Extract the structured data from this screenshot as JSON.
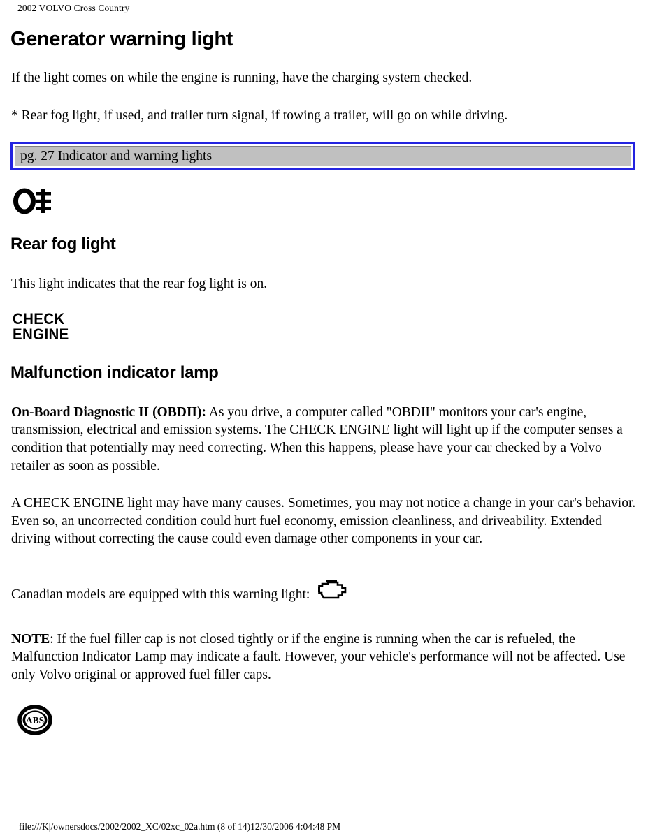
{
  "document": {
    "running_header": "2002 VOLVO Cross Country",
    "footer": "file:///K|/ownersdocs/2002/2002_XC/02xc_02a.htm (8 of 14)12/30/2006 4:04:48 PM"
  },
  "colors": {
    "link_box_border": "#2323e0",
    "link_box_fill": "#c0c0c0",
    "link_box_inner_border": "#808080",
    "text": "#000000",
    "page_background": "#ffffff"
  },
  "sections": {
    "generator": {
      "heading": "Generator warning light",
      "paragraph": "If the light comes on while the engine is running, have the charging system checked.",
      "footnote": "* Rear fog light, if used, and trailer turn signal, if towing a trailer, will go on while driving."
    },
    "link_box": {
      "label": "pg. 27 Indicator and warning lights"
    },
    "rear_fog": {
      "icon_name": "rear-fog-light-symbol",
      "heading": "Rear fog light",
      "paragraph": "This light indicates that the rear fog light is on."
    },
    "malfunction": {
      "icon_line1": "CHECK",
      "icon_line2": "ENGINE",
      "heading": "Malfunction indicator lamp",
      "paragraph_1_bold": "On-Board Diagnostic II (OBDII):",
      "paragraph_1_rest": " As you drive, a computer called \"OBDII\" monitors your car's engine, transmission, electrical and emission systems. The CHECK ENGINE light will light up if the computer senses a condition that potentially may need correcting. When this happens, please have your car checked by a Volvo retailer as soon as possible.",
      "paragraph_2": "A CHECK ENGINE light may have many causes. Sometimes, you may not notice a change in your car's behavior. Even so, an uncorrected condition could hurt fuel economy, emission cleanliness, and driveability. Extended driving without correcting the cause could even damage other components in your car.",
      "canadian_line": "Canadian models are equipped with this warning light:",
      "canadian_icon_name": "engine-block-symbol",
      "note_bold": "NOTE",
      "note_rest": ": If the fuel filler cap is not closed tightly or if the engine is running when the car is refueled, the Malfunction Indicator Lamp may indicate a fault. However, your vehicle's performance will not be affected. Use only Volvo original or approved fuel filler caps."
    },
    "abs": {
      "icon_name": "abs-warning-symbol",
      "icon_text": "ABS"
    }
  }
}
